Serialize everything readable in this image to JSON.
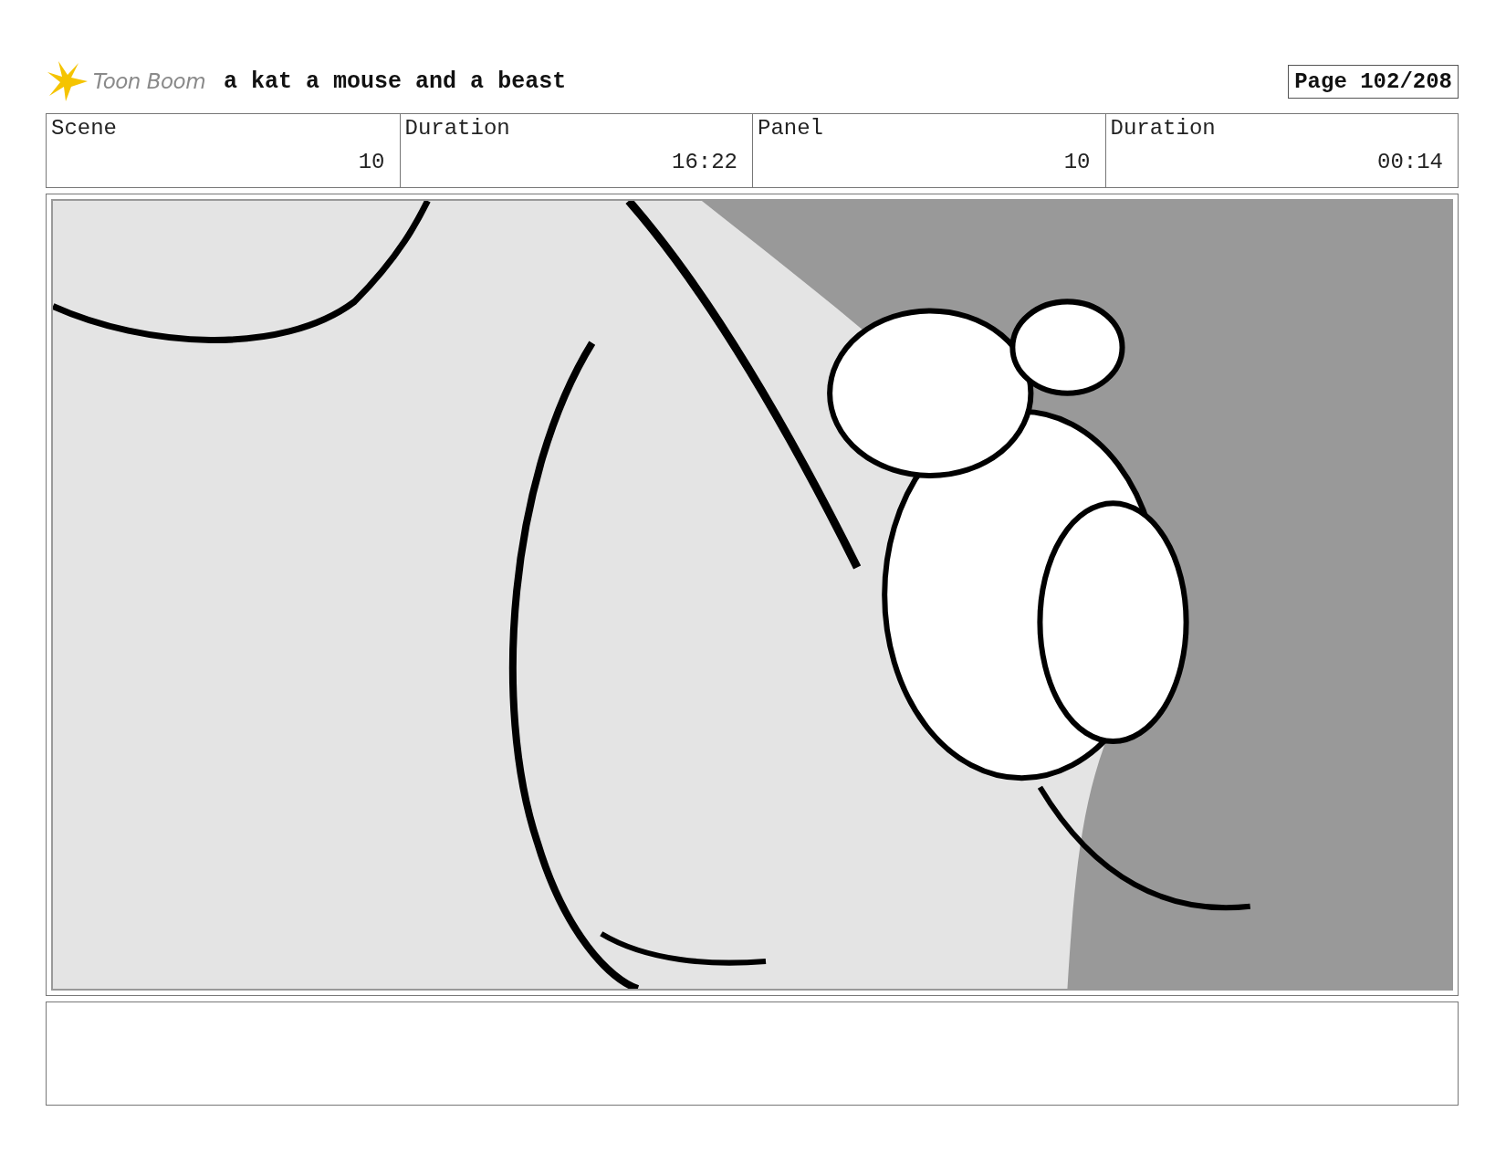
{
  "header": {
    "logo": "Toon Boom",
    "title": "a kat a mouse and a beast",
    "page": "Page 102/208"
  },
  "info": [
    {
      "label": "Scene",
      "value": "10"
    },
    {
      "label": "Duration",
      "value": "16:22"
    },
    {
      "label": "Panel",
      "value": "10"
    },
    {
      "label": "Duration",
      "value": "00:14"
    }
  ]
}
